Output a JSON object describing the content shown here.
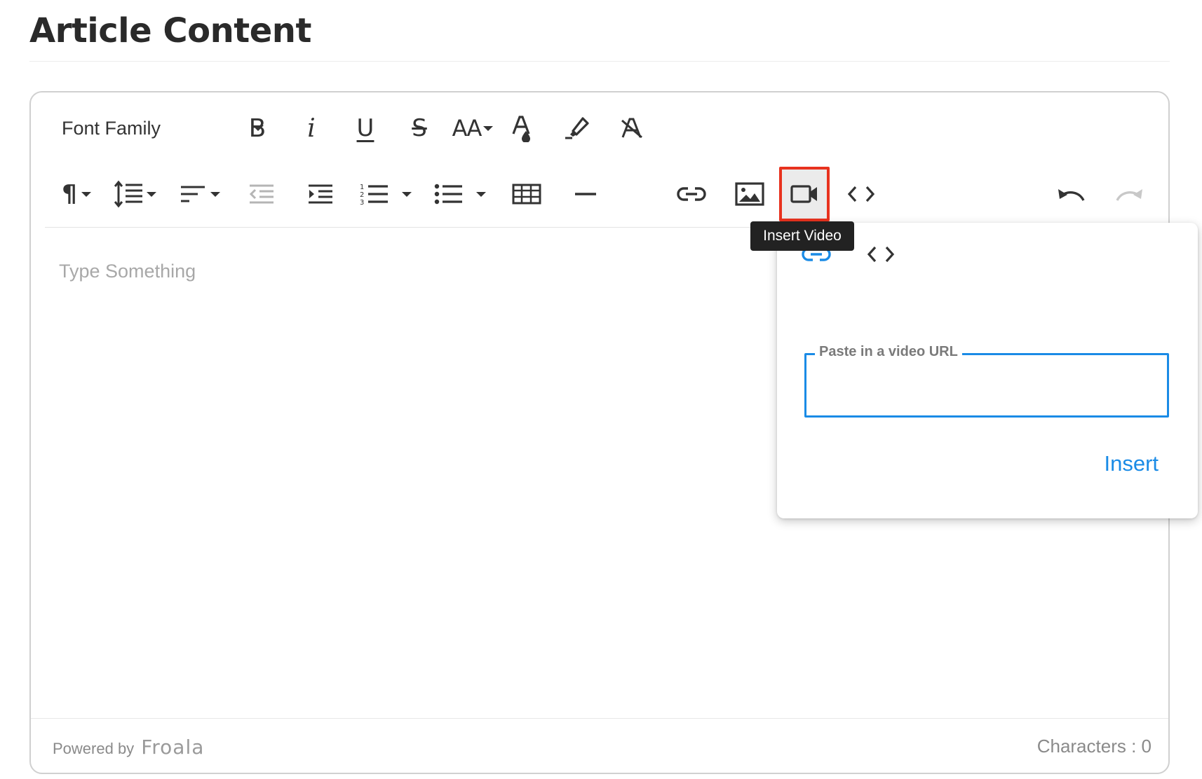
{
  "page": {
    "title": "Article Content"
  },
  "toolbar": {
    "row1": {
      "font_family_label": "Font Family",
      "bold_label": "B",
      "italic_label": "i",
      "underline_label": "U",
      "strikethrough_label": "S",
      "font_size_label": "AA",
      "icons": [
        "text-color-icon",
        "highlight-icon",
        "clear-formatting-icon"
      ]
    },
    "row2": {
      "icons": [
        "paragraph-format-icon",
        "line-height-icon",
        "align-icon",
        "outdent-icon",
        "indent-icon",
        "ordered-list-icon",
        "unordered-list-icon",
        "table-icon",
        "horizontal-line-icon",
        "link-icon",
        "image-icon",
        "video-icon",
        "code-view-icon",
        "undo-icon",
        "redo-icon"
      ],
      "active_button": "video-icon"
    }
  },
  "tooltip": {
    "text": "Insert Video"
  },
  "video_popup": {
    "tabs": [
      {
        "name": "by-url",
        "icon": "link-icon",
        "active": true
      },
      {
        "name": "by-embed",
        "icon": "code-icon",
        "active": false
      }
    ],
    "url_field": {
      "label": "Paste in a video URL",
      "value": ""
    },
    "insert_label": "Insert"
  },
  "editor": {
    "placeholder": "Type Something"
  },
  "footer": {
    "powered_by": "Powered by",
    "brand": "Froala",
    "characters_label": "Characters : 0"
  },
  "colors": {
    "accent_blue": "#1a8be6",
    "highlight_red": "#e8321e",
    "tooltip_bg": "#222222"
  }
}
